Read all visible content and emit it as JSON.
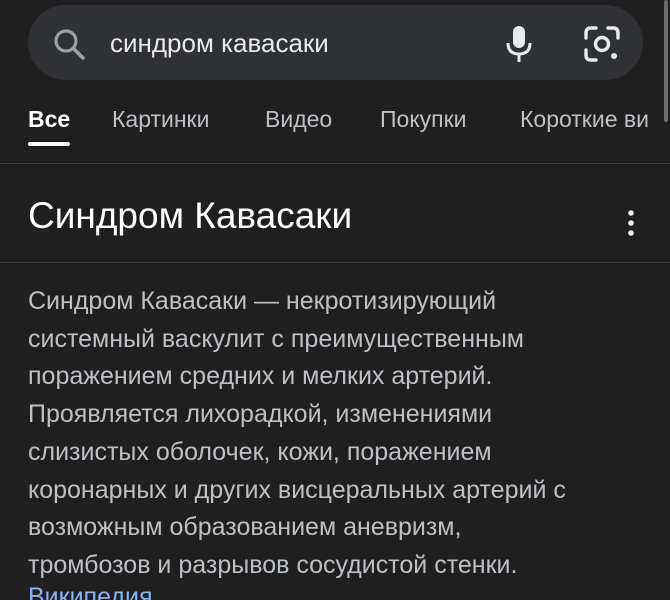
{
  "search": {
    "query": "синдром кавасаки",
    "icons": [
      "search-icon",
      "mic-icon",
      "lens-icon"
    ]
  },
  "tabs": [
    {
      "label": "Все",
      "active": true
    },
    {
      "label": "Картинки",
      "active": false
    },
    {
      "label": "Видео",
      "active": false
    },
    {
      "label": "Покупки",
      "active": false
    },
    {
      "label": "Короткие ви",
      "active": false
    }
  ],
  "knowledge_panel": {
    "title": "Синдром Кавасаки",
    "description_lines": [
      "Синдром Кавасаки — некротизирующий",
      "системный васкулит с преимущественным",
      "поражением средних и мелких артерий.",
      "Проявляется лихорадкой, изменениями",
      "слизистых оболочек, кожи, поражением",
      "коронарных и других висцеральных артерий с",
      "возможным образованием аневризм,",
      "тромбозов и разрывов сосудистой стенки."
    ],
    "source_label": "Википедия"
  },
  "colors": {
    "background": "#1f1f1f",
    "search_bar": "#303134",
    "text_primary": "#ffffff",
    "text_secondary": "#bdc1c6",
    "link": "#8ab4f8"
  }
}
